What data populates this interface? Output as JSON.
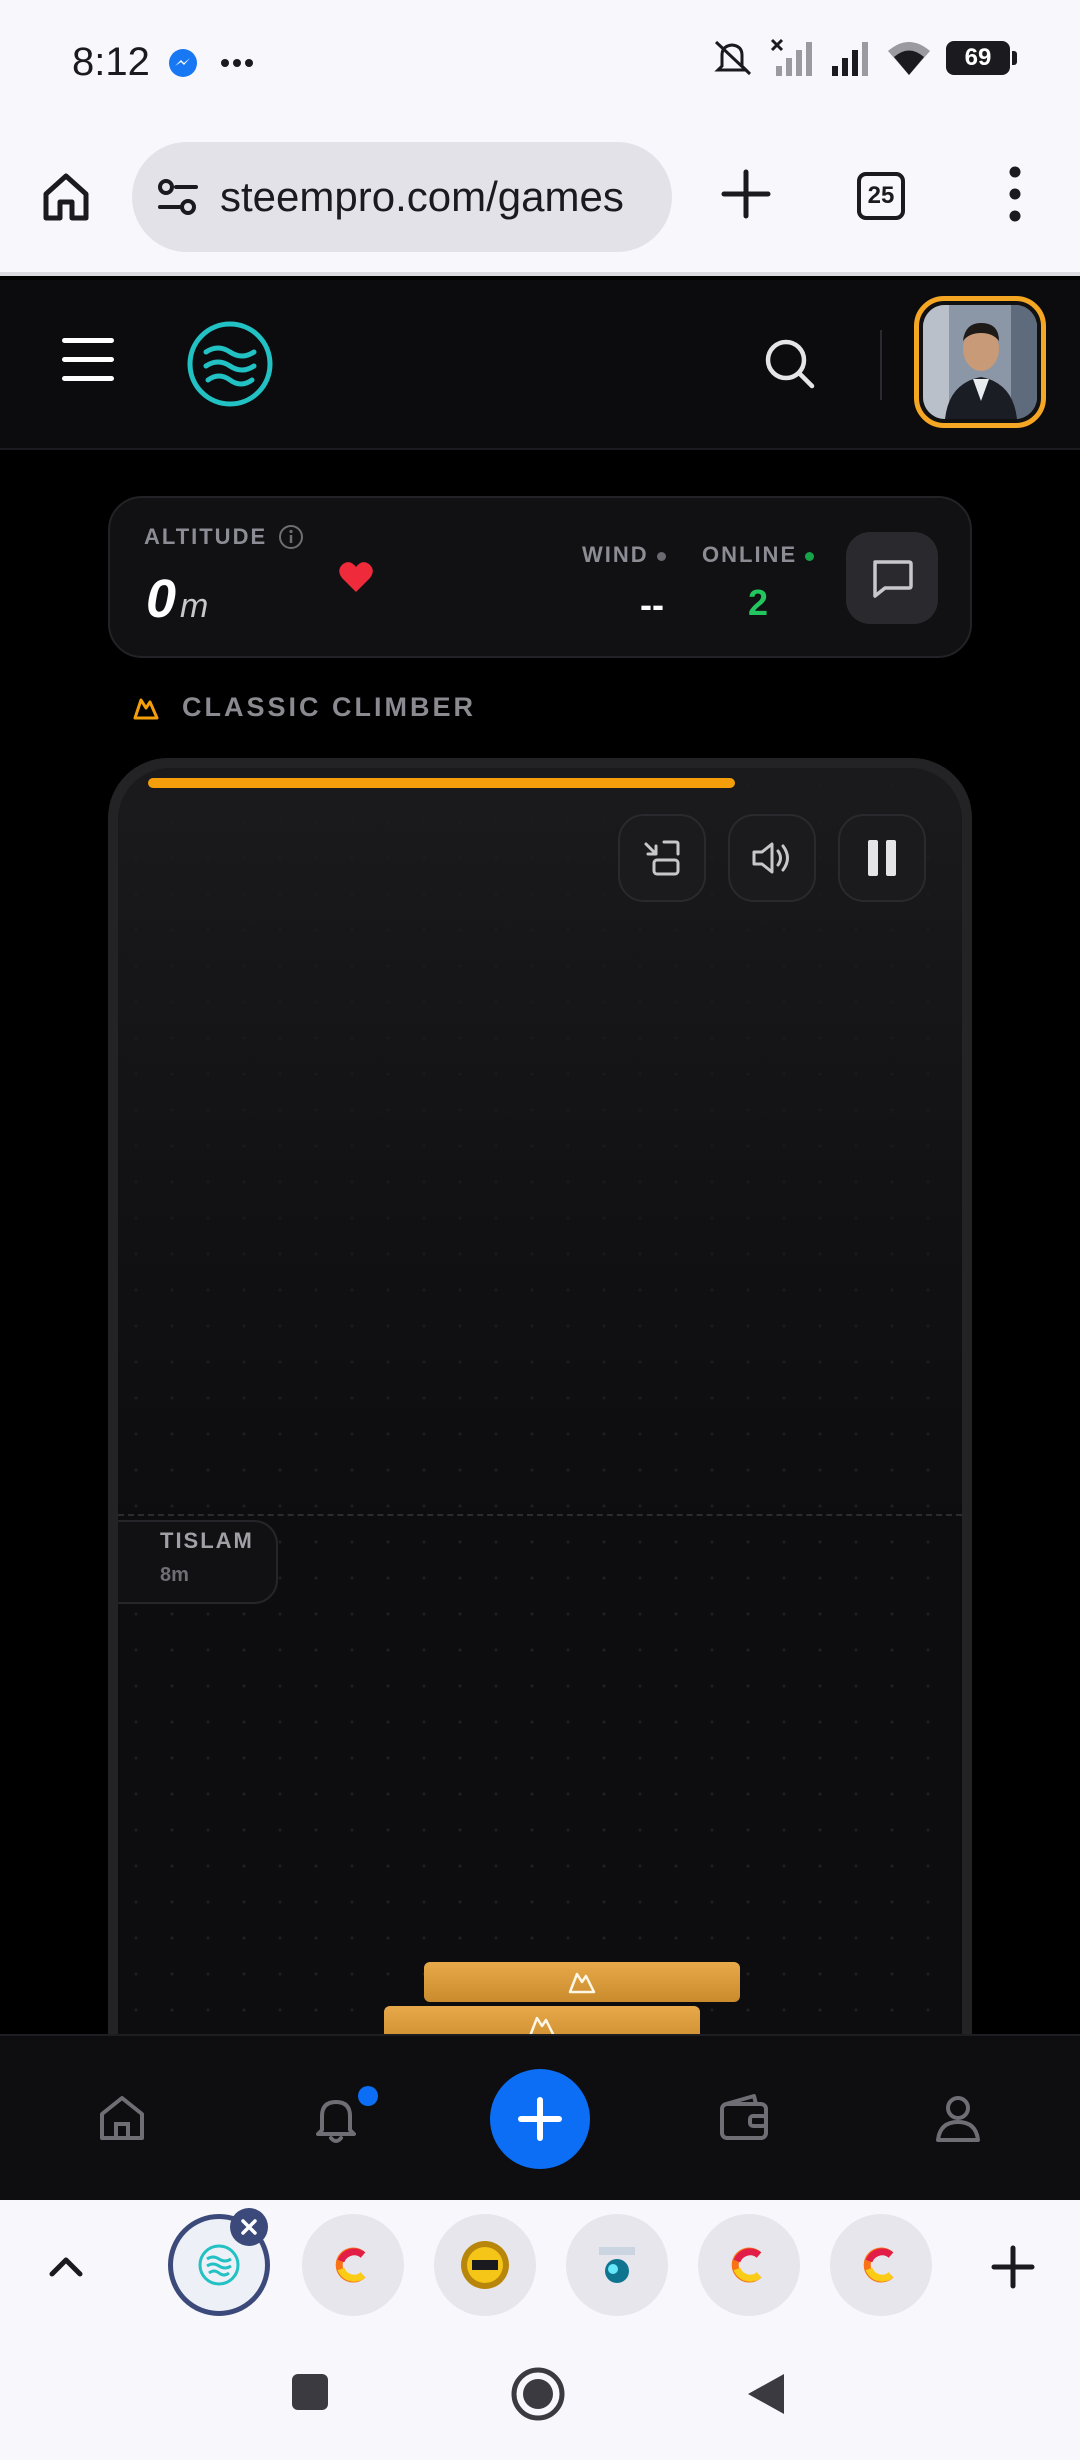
{
  "status_bar": {
    "time": "8:12",
    "battery": "69",
    "icons": [
      "messenger-icon",
      "more-dots-icon",
      "mute-icon",
      "signal-x-icon",
      "signal-icon",
      "wifi-icon",
      "battery-icon"
    ]
  },
  "browser": {
    "url": "steempro.com/games",
    "tab_count": "25"
  },
  "stats": {
    "altitude_label": "ALTITUDE",
    "altitude_value": "0",
    "altitude_unit": "m",
    "wind_label": "WIND",
    "wind_value": "--",
    "online_label": "ONLINE",
    "online_value": "2"
  },
  "mode": {
    "label": "CLASSIC CLIMBER"
  },
  "game": {
    "progress": 0.66,
    "player": {
      "name": "TISLAM",
      "altitude": "8m"
    }
  },
  "colors": {
    "accent": "#f59e0b",
    "online": "#22c55e",
    "fab": "#0b6ef5",
    "heart": "#ef2b3b"
  }
}
